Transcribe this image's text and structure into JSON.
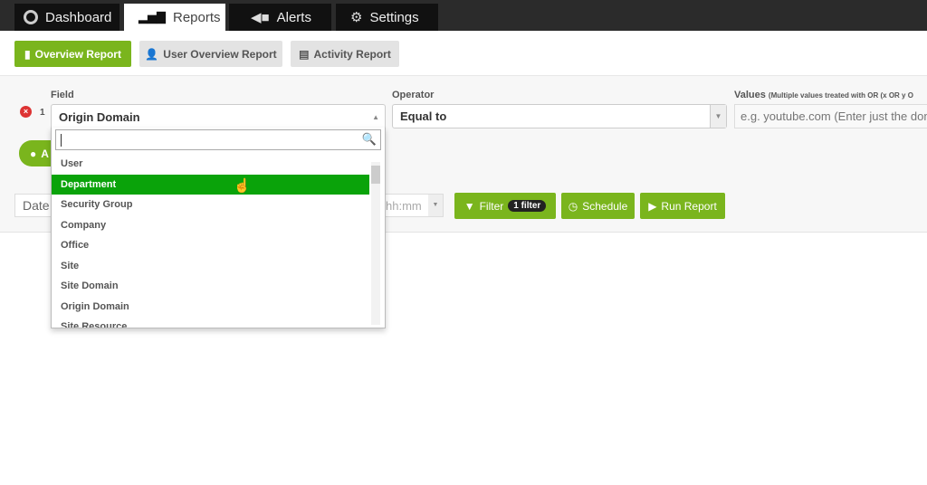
{
  "nav": {
    "tabs": [
      {
        "label": "Dashboard",
        "icon": "dashboard-gauge-icon"
      },
      {
        "label": "Reports",
        "icon": "bar-chart-icon",
        "active": true
      },
      {
        "label": "Alerts",
        "icon": "megaphone-icon"
      },
      {
        "label": "Settings",
        "icon": "gears-icon"
      }
    ]
  },
  "report_tabs": [
    {
      "label": "Overview Report",
      "active": true
    },
    {
      "label": "User Overview Report"
    },
    {
      "label": "Activity Report"
    }
  ],
  "filter": {
    "field_label": "Field",
    "operator_label": "Operator",
    "values_label": "Values",
    "values_hint": "(Multiple values treated with OR (x OR y O",
    "row_number": "1",
    "field_value": "Origin Domain",
    "operator_value": "Equal to",
    "values_placeholder": "e.g. youtube.com (Enter just the dom",
    "add_label": "A"
  },
  "dropdown": {
    "search_value": "",
    "items": [
      "User",
      "Department",
      "Security Group",
      "Company",
      "Office",
      "Site",
      "Site Domain",
      "Origin Domain",
      "Site Resource"
    ],
    "highlighted": "Department"
  },
  "toolbar": {
    "date_label": "Date",
    "time_placeholder": "hh:mm",
    "filter_label": "Filter",
    "filter_badge": "1 filter",
    "schedule_label": "Schedule",
    "run_label": "Run Report"
  },
  "colors": {
    "accent": "#7ab51d",
    "highlight": "#0aa30a",
    "topbar": "#2b2b2b"
  }
}
